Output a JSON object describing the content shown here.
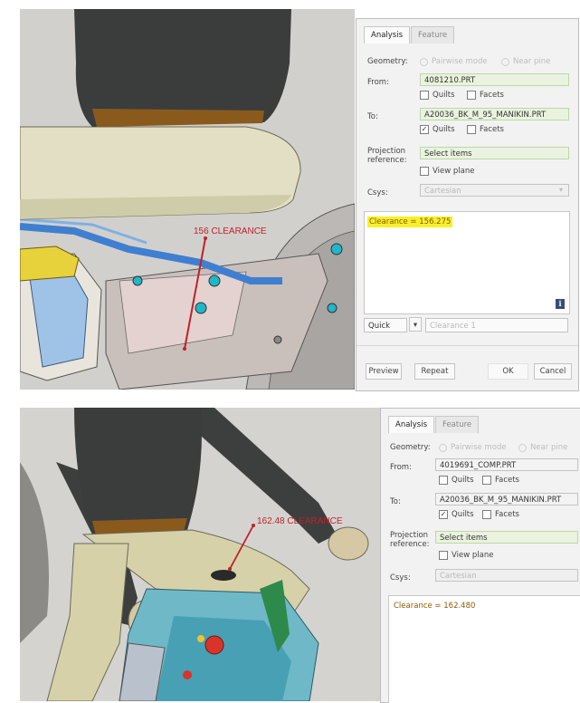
{
  "top": {
    "annotation": "156 CLEARANCE",
    "dialog": {
      "tabs": [
        "Analysis",
        "Feature"
      ],
      "geometry_label": "Geometry:",
      "geometry_options": [
        "Pairwise mode",
        "Near pine"
      ],
      "from_label": "From:",
      "from_value": "4081210.PRT",
      "quilts_label": "Quilts",
      "facets_label": "Facets",
      "to_label": "To:",
      "to_value": "A20036_BK_M_95_MANIKIN.PRT",
      "projection_label": "Projection reference:",
      "select_items": "Select items",
      "view_plane": "View plane",
      "csys_label": "Csys:",
      "csys_value": "Cartesian",
      "clearance_text": "Clearance = 156.275",
      "mode_value": "Quick",
      "name_placeholder": "Clearance 1",
      "preview": "Preview",
      "repeat": "Repeat",
      "ok": "OK",
      "cancel": "Cancel"
    }
  },
  "bottom": {
    "annotation": "162.48 CLEARANCE",
    "dialog": {
      "tabs": [
        "Analysis",
        "Feature"
      ],
      "geometry_label": "Geometry:",
      "geometry_options": [
        "Pairwise mode",
        "Near pine"
      ],
      "from_label": "From:",
      "from_value": "4019691_COMP.PRT",
      "quilts_label": "Quilts",
      "facets_label": "Facets",
      "to_label": "To:",
      "to_value": "A20036_BK_M_95_MANIKIN.PRT",
      "projection_label": "Projection reference:",
      "select_items": "Select items",
      "view_plane": "View plane",
      "csys_label": "Csys:",
      "csys_value": "Cartesian",
      "clearance_text": "Clearance = 162.480"
    }
  },
  "colors": {
    "annotation": "#c0202a",
    "highlight": "#f7f02a",
    "select_green": "#e9f3df"
  }
}
